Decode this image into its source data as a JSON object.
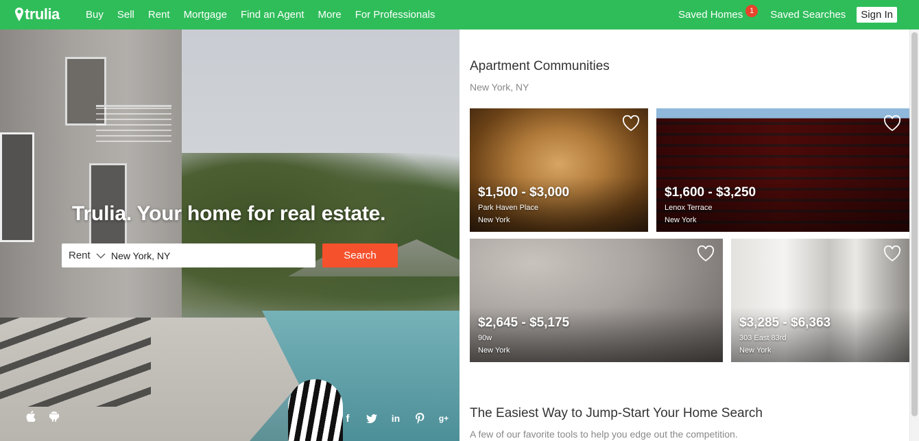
{
  "brand": {
    "logo_text": "trulia",
    "logo_icon": "map-pin-icon",
    "brand_color": "#2fbd5a"
  },
  "nav": {
    "links": [
      "Buy",
      "Sell",
      "Rent",
      "Mortgage",
      "Find an Agent",
      "More",
      "For Professionals"
    ],
    "saved_homes": "Saved Homes",
    "saved_homes_count": "1",
    "saved_searches": "Saved Searches",
    "sign_in": "Sign In"
  },
  "hero": {
    "title": "Trulia. Your home for real estate.",
    "search": {
      "type_selected": "Rent",
      "location_value": "New York, NY",
      "button_label": "Search",
      "button_color": "#f5512c"
    },
    "app_icons": [
      "apple-icon",
      "android-icon"
    ],
    "social_icons": [
      "facebook-icon",
      "twitter-icon",
      "linkedin-icon",
      "pinterest-icon",
      "google-plus-icon"
    ]
  },
  "communities": {
    "title": "Apartment Communities",
    "location": "New York, NY",
    "cards": [
      {
        "price": "$1,500 - $3,000",
        "name": "Park Haven Place",
        "city": "New York"
      },
      {
        "price": "$1,600 - $3,250",
        "name": "Lenox Terrace",
        "city": "New York"
      },
      {
        "price": "$2,645 - $5,175",
        "name": "90w",
        "city": "New York"
      },
      {
        "price": "$3,285 - $6,363",
        "name": "303 East 83rd",
        "city": "New York"
      }
    ]
  },
  "tools": {
    "title": "The Easiest Way to Jump-Start Your Home Search",
    "subtitle": "A few of our favorite tools to help you edge out the competition."
  }
}
